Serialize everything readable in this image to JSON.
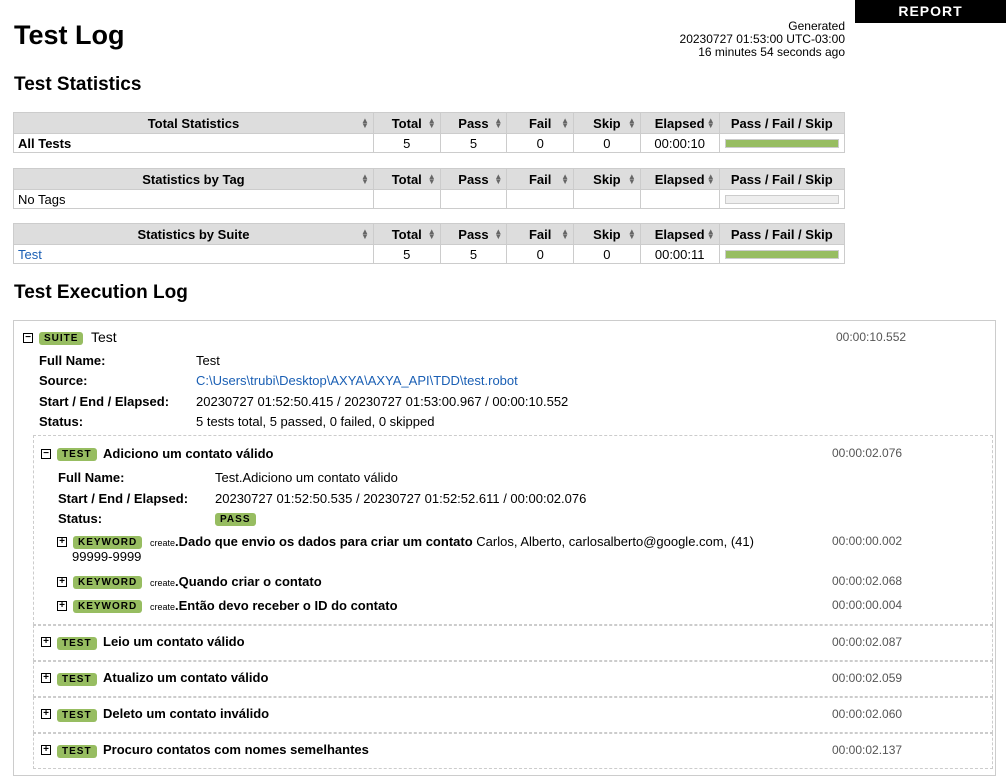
{
  "report_button": "REPORT",
  "title": "Test Log",
  "generated": {
    "label": "Generated",
    "timestamp": "20230727 01:53:00 UTC-03:00",
    "ago": "16 minutes 54 seconds ago"
  },
  "statistics_heading": "Test Statistics",
  "columns": [
    "Total",
    "Pass",
    "Fail",
    "Skip",
    "Elapsed",
    "Pass / Fail / Skip"
  ],
  "total_stats": {
    "header": "Total Statistics",
    "rows": [
      {
        "name": "All Tests",
        "total": "5",
        "pass": "5",
        "fail": "0",
        "skip": "0",
        "elapsed": "00:00:10",
        "pass_ratio": 1.0
      }
    ]
  },
  "tag_stats": {
    "header": "Statistics by Tag",
    "rows": [
      {
        "name": "No Tags",
        "total": "",
        "pass": "",
        "fail": "",
        "skip": "",
        "elapsed": "",
        "pass_ratio": 0
      }
    ]
  },
  "suite_stats": {
    "header": "Statistics by Suite",
    "rows": [
      {
        "name": "Test",
        "total": "5",
        "pass": "5",
        "fail": "0",
        "skip": "0",
        "elapsed": "00:00:11",
        "pass_ratio": 1.0
      }
    ]
  },
  "execution_heading": "Test Execution Log",
  "suite": {
    "badge": "SUITE",
    "name": "Test",
    "elapsed": "00:00:10.552",
    "full_name_label": "Full Name:",
    "full_name": "Test",
    "source_label": "Source:",
    "source": "C:\\Users\\trubi\\Desktop\\AXYA\\AXYA_API\\TDD\\test.robot",
    "times_label": "Start / End / Elapsed:",
    "times": "20230727 01:52:50.415 / 20230727 01:53:00.967 / 00:00:10.552",
    "status_label": "Status:",
    "status": "5 tests total, 5 passed, 0 failed, 0 skipped"
  },
  "expanded_test": {
    "badge": "TEST",
    "name": "Adiciono um contato válido",
    "elapsed": "00:00:02.076",
    "full_name_label": "Full Name:",
    "full_name": "Test.Adiciono um contato válido",
    "times_label": "Start / End / Elapsed:",
    "times": "20230727 01:52:50.535 / 20230727 01:52:52.611 / 00:00:02.076",
    "status_label": "Status:",
    "status": "PASS",
    "keywords": [
      {
        "badge": "KEYWORD",
        "lib": "create",
        "name": "Dado que envio os dados para criar um contato",
        "args_line1": "Carlos, Alberto, carlosalberto@google.com, (41)",
        "args_line2": "99999-9999",
        "elapsed": "00:00:00.002"
      },
      {
        "badge": "KEYWORD",
        "lib": "create",
        "name": "Quando criar o contato",
        "elapsed": "00:00:02.068"
      },
      {
        "badge": "KEYWORD",
        "lib": "create",
        "name": "Então devo receber o ID do contato",
        "elapsed": "00:00:00.004"
      }
    ]
  },
  "collapsed_tests": [
    {
      "badge": "TEST",
      "name": "Leio um contato válido",
      "elapsed": "00:00:02.087"
    },
    {
      "badge": "TEST",
      "name": "Atualizo um contato válido",
      "elapsed": "00:00:02.059"
    },
    {
      "badge": "TEST",
      "name": "Deleto um contato inválido",
      "elapsed": "00:00:02.060"
    },
    {
      "badge": "TEST",
      "name": "Procuro contatos com nomes semelhantes",
      "elapsed": "00:00:02.137"
    }
  ],
  "colors": {
    "pass": "#97bd61",
    "header_bg": "#dddddd",
    "link": "#1a5fb4"
  }
}
